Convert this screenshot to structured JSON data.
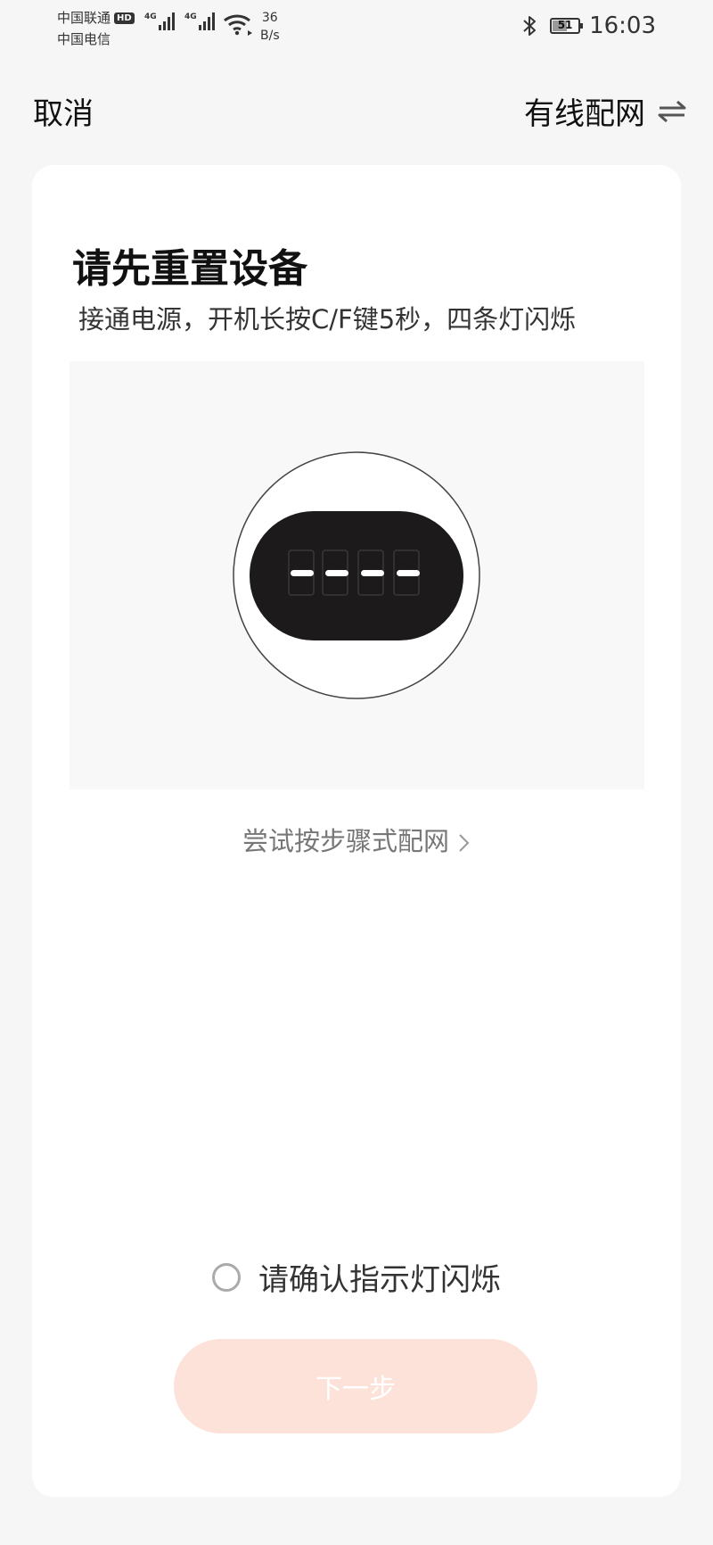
{
  "status_bar": {
    "carrier1": "中国联通",
    "hd_badge": "HD",
    "carrier2": "中国电信",
    "network_tag1": "4G",
    "network_tag2": "4G",
    "net_speed_value": "36",
    "net_speed_unit": "B/s",
    "battery_level": "51",
    "time": "16:03"
  },
  "header": {
    "cancel_label": "取消",
    "wired_setup_label": "有线配网",
    "wired_setup_icon": "switch-arrows-icon"
  },
  "card": {
    "title": "请先重置设备",
    "subtitle": "接通电源，开机长按C/F键5秒，四条灯闪烁",
    "illustration_icon": "device-display-icon",
    "step_link_label": "尝试按步骤式配网",
    "confirm_label": "请确认指示灯闪烁",
    "next_label": "下一步"
  },
  "colors": {
    "page_bg": "#f6f6f6",
    "card_bg": "#ffffff",
    "next_button_bg": "#fde2da",
    "device_body": "#1c1a1b"
  }
}
